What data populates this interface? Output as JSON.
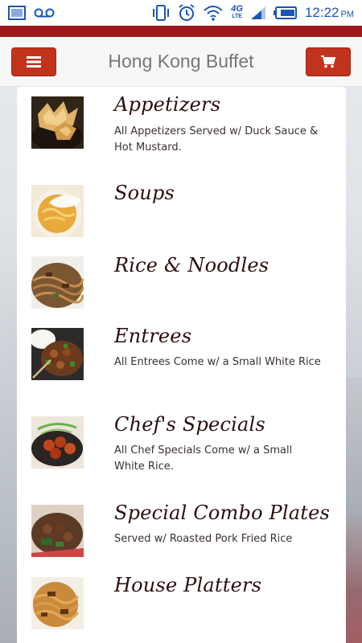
{
  "status_bar": {
    "time": "12:22",
    "meridiem": "PM",
    "network_label": "4G",
    "network_sub": "LTE",
    "left_icons": [
      "image-icon",
      "voicemail-icon"
    ],
    "right_icons": [
      "vibrate-icon",
      "alarm-icon",
      "wifi-icon",
      "network-4g-lte-icon",
      "signal-icon",
      "battery-icon"
    ]
  },
  "header": {
    "title": "Hong Kong Buffet",
    "menu_icon": "hamburger-icon",
    "cart_icon": "cart-icon",
    "accent_color": "#9c1a1c",
    "button_color": "#c1331d"
  },
  "categories": [
    {
      "name": "Appetizers",
      "description": "All Appetizers Served w/ Duck Sauce & Hot Mustard.",
      "image": "crab-rangoon-thumbnail"
    },
    {
      "name": "Soups",
      "description": "",
      "image": "egg-drop-soup-thumbnail"
    },
    {
      "name": "Rice & Noodles",
      "description": "",
      "image": "lo-mein-thumbnail"
    },
    {
      "name": "Entrees",
      "description": "All Entrees Come w/ a Small White Rice",
      "image": "kung-pao-thumbnail"
    },
    {
      "name": "Chef's Specials",
      "description": "All Chef Specials Come w/ a Small White Rice.",
      "image": "general-tso-thumbnail"
    },
    {
      "name": "Special Combo Plates",
      "description": "Served w/ Roasted Pork Fried Rice",
      "image": "combo-plate-thumbnail"
    },
    {
      "name": "House Platters",
      "description": "",
      "image": "noodle-platter-thumbnail"
    }
  ]
}
